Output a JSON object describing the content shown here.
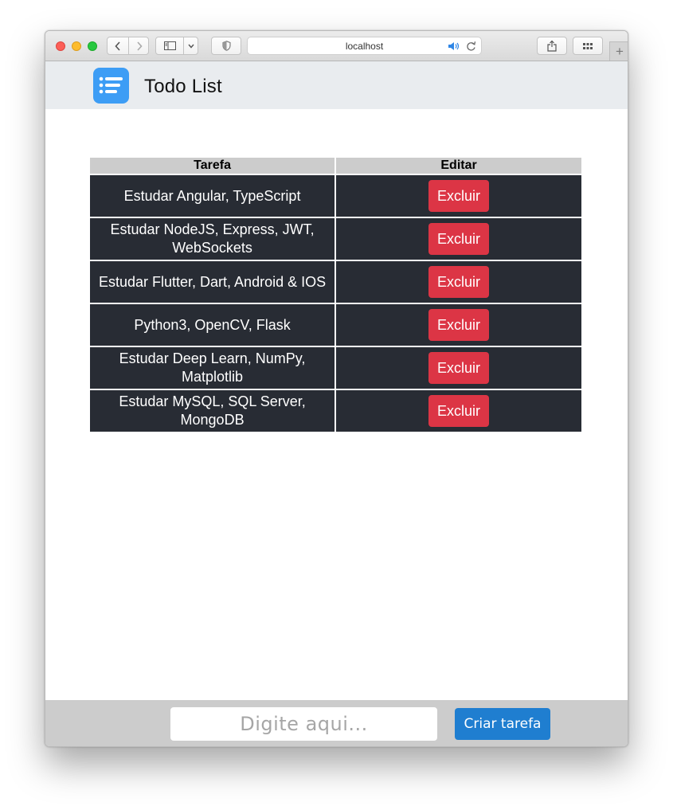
{
  "browser": {
    "url": "localhost",
    "new_tab_label": "+"
  },
  "app": {
    "title": "Todo List",
    "logo_icon": "list-icon",
    "accent_color": "#3d9df5"
  },
  "table": {
    "headers": [
      "Tarefa",
      "Editar"
    ],
    "rows": [
      {
        "task": "Estudar Angular, TypeScript",
        "action": "Excluir"
      },
      {
        "task": "Estudar NodeJS, Express, JWT, WebSockets",
        "action": "Excluir"
      },
      {
        "task": "Estudar Flutter, Dart, Android & IOS",
        "action": "Excluir"
      },
      {
        "task": "Python3, OpenCV, Flask",
        "action": "Excluir"
      },
      {
        "task": "Estudar Deep Learn, NumPy, Matplotlib",
        "action": "Excluir"
      },
      {
        "task": "Estudar MySQL, SQL Server, MongoDB",
        "action": "Excluir"
      }
    ],
    "row_color": "#282c34",
    "delete_color": "#dc3545"
  },
  "footer": {
    "input_placeholder": "Digite aqui...",
    "input_value": "",
    "create_label": "Criar tarefa",
    "create_color": "#1f7ed0"
  }
}
